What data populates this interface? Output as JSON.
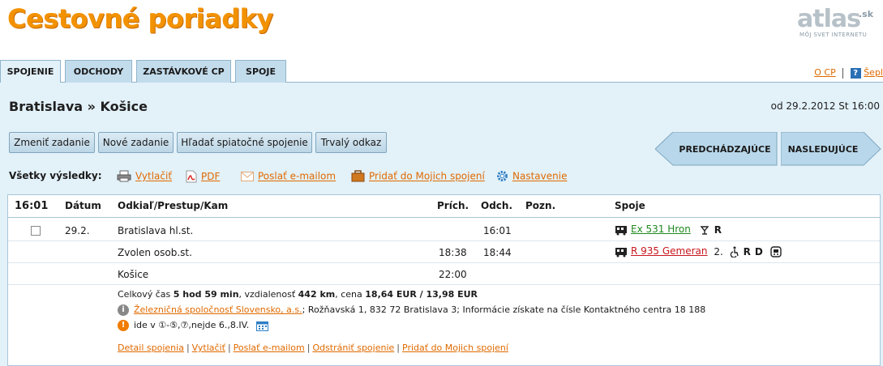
{
  "header": {
    "title": "Cestovné poriadky",
    "brand": "atlas",
    "brand_suffix": ".sk",
    "brand_slogan": "MÔJ SVET INTERNETU"
  },
  "tabs": [
    {
      "label": "SPOJENIE",
      "active": true
    },
    {
      "label": "ODCHODY",
      "active": false
    },
    {
      "label": "ZASTÁVKOVÉ CP",
      "active": false
    },
    {
      "label": "SPOJE",
      "active": false
    }
  ],
  "top_links": {
    "about": "O CP",
    "help": "Šepl"
  },
  "route": {
    "title": "Bratislava » Košice",
    "date": "od 29.2.2012 St 16:00"
  },
  "buttons": {
    "change": "Zmeniť zadanie",
    "new": "Nové zadanie",
    "return": "Hľadať spiatočné spojenie",
    "permalink": "Trvalý odkaz",
    "prev": "PREDCHÁDZAJÚCE",
    "next": "NASLEDUJÚCE"
  },
  "results_bar": {
    "label": "Všetky výsledky:",
    "print": "Vytlačiť",
    "pdf": "PDF",
    "email": "Poslať e-mailom",
    "add": "Pridať do Mojich spojení",
    "settings": "Nastavenie"
  },
  "table": {
    "headers": {
      "time": "16:01",
      "date": "Dátum",
      "route": "Odkiaľ/Prestup/Kam",
      "arr": "Prích.",
      "dep": "Odch.",
      "note": "Pozn.",
      "trains": "Spoje"
    },
    "date": "29.2.",
    "stops": [
      {
        "name": "Bratislava hl.st.",
        "arr": "",
        "dep": "16:01"
      },
      {
        "name": "Zvolen osob.st.",
        "arr": "18:38",
        "dep": "18:44"
      },
      {
        "name": "Košice",
        "arr": "22:00",
        "dep": ""
      }
    ],
    "trains": [
      {
        "label": "Ex 531 Hron",
        "color": "#1f8a1f",
        "class_text": "",
        "services": [
          "R"
        ]
      },
      {
        "label": "R 935 Gemeran",
        "color": "#c8161d",
        "class_text": "2.",
        "services": [
          "R",
          "D"
        ]
      }
    ],
    "summary": {
      "prefix": "Celkový čas ",
      "duration": "5 hod 59 min",
      "mid1": ", vzdialenosť ",
      "distance": "442 km",
      "mid2": ", cena ",
      "price": "18,64 EUR / 13,98 EUR"
    },
    "carrier": {
      "link": "Železničná spoločnosť Slovensko, a.s.",
      "text": "; Rožňavská 1, 832 72 Bratislava 3; Informácie získate na čísle Kontaktného centra 18 188"
    },
    "days": "ide v ①-⑤,⑦,nejde 6.,8.IV.",
    "bottom_links": [
      "Detail spojenia",
      "Vytlačiť",
      "Poslať e-mailom",
      "Odstrániť spojenie",
      "Pridať do Mojich spojení"
    ]
  }
}
